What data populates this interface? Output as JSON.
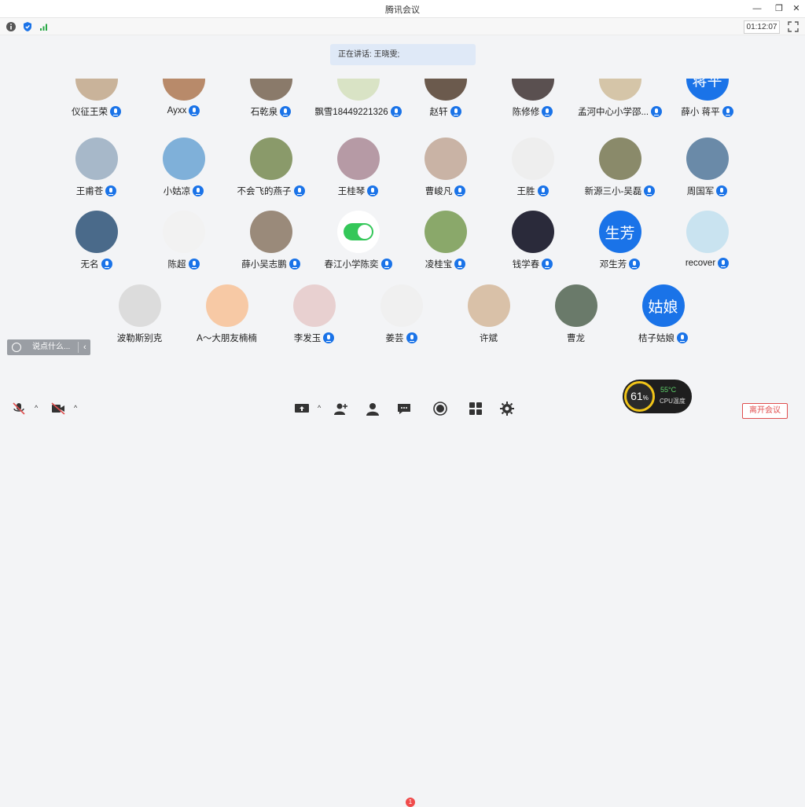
{
  "window": {
    "title": "腾讯会议"
  },
  "top": {
    "timer": "01:12:07"
  },
  "speaking": {
    "text": "正在讲话: 王晓雯;"
  },
  "participants": [
    {
      "name": "仪征王荣",
      "bg": "#c9b39a",
      "avatar_text": ""
    },
    {
      "name": "Ayxx",
      "bg": "#b88a6a",
      "avatar_text": ""
    },
    {
      "name": "石乾泉",
      "bg": "#8a7a6a",
      "avatar_text": ""
    },
    {
      "name": "飘雪18449221326",
      "bg": "#d9e3c5",
      "avatar_text": ""
    },
    {
      "name": "赵轩",
      "bg": "#6b5a4d",
      "avatar_text": ""
    },
    {
      "name": "陈修修",
      "bg": "#5a5050",
      "avatar_text": ""
    },
    {
      "name": "孟河中心小学邵...",
      "bg": "#d5c5a8",
      "avatar_text": ""
    },
    {
      "name": "薛小 蒋平",
      "bg": "#1a73e8",
      "avatar_text": "蒋平"
    },
    {
      "name": "王甫苍",
      "bg": "#a7b8c9",
      "avatar_text": ""
    },
    {
      "name": "小姑凉",
      "bg": "#7fb0d9",
      "avatar_text": ""
    },
    {
      "name": "不会飞的燕子",
      "bg": "#8a9a6a",
      "avatar_text": ""
    },
    {
      "name": "王桂琴",
      "bg": "#b69aa5",
      "avatar_text": ""
    },
    {
      "name": "曹峻凡",
      "bg": "#c9b3a5",
      "avatar_text": ""
    },
    {
      "name": "王胜",
      "bg": "#eeeeee",
      "avatar_text": ""
    },
    {
      "name": "新源三小-吴磊",
      "bg": "#8a8a6a",
      "avatar_text": ""
    },
    {
      "name": "周国军",
      "bg": "#6a8aa8",
      "avatar_text": ""
    },
    {
      "name": "无名",
      "bg": "#4a6a8a",
      "avatar_text": ""
    },
    {
      "name": "陈超",
      "bg": "#f2f2f2",
      "avatar_text": ""
    },
    {
      "name": "薛小吴志鹏",
      "bg": "#9a8a7a",
      "avatar_text": ""
    },
    {
      "name": "春江小学陈奕",
      "bg": "#ffffff",
      "avatar_text": ""
    },
    {
      "name": "凌桂宝",
      "bg": "#8aa86a",
      "avatar_text": ""
    },
    {
      "name": "钱学春",
      "bg": "#2a2a3a",
      "avatar_text": ""
    },
    {
      "name": "邓生芳",
      "bg": "#1a73e8",
      "avatar_text": "生芳"
    },
    {
      "name": "recover",
      "bg": "#c9e3f0",
      "avatar_text": ""
    },
    {
      "name": "波勒斯别克",
      "bg": "#dcdcdc",
      "avatar_text": ""
    },
    {
      "name": "A～大朋友楠楠",
      "bg": "#f7c9a5",
      "avatar_text": ""
    },
    {
      "name": "李发玉",
      "bg": "#e8d0d0",
      "avatar_text": ""
    },
    {
      "name": "姜芸",
      "bg": "#f0f0f0",
      "avatar_text": ""
    },
    {
      "name": "许斌",
      "bg": "#d9c1a8",
      "avatar_text": ""
    },
    {
      "name": "曹龙",
      "bg": "#6a7a6a",
      "avatar_text": ""
    },
    {
      "name": "桔子姑娘",
      "bg": "#1a73e8",
      "avatar_text": "姑娘"
    }
  ],
  "chat": {
    "placeholder": "说点什么..."
  },
  "cpu": {
    "percent": "61",
    "percent_unit": "%",
    "temp": "55°C",
    "label": "CPU温度"
  },
  "bottom": {
    "leave_label": "离开会议",
    "chat_badge": "1"
  },
  "colors": {
    "accent": "#1a73e8",
    "danger": "#e04f4f"
  }
}
